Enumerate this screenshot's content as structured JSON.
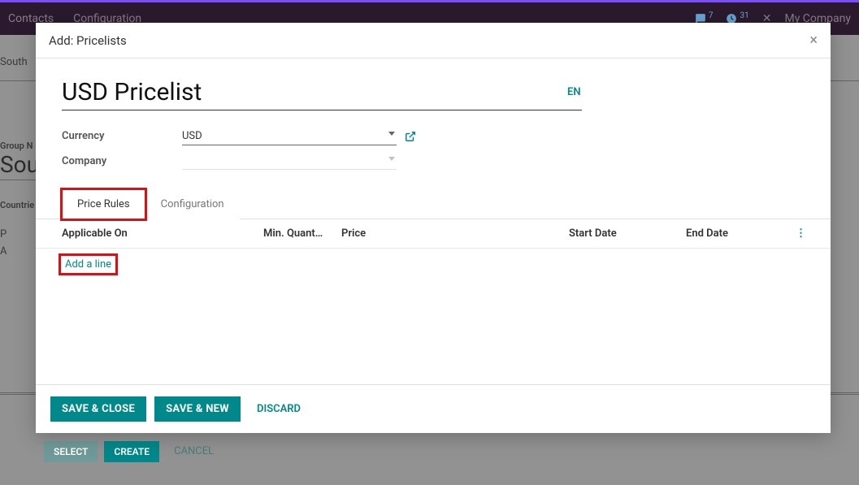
{
  "topnav": {
    "items": [
      "Contacts",
      "Configuration"
    ],
    "badges": {
      "messages": 7,
      "activities": 31
    },
    "company": "My Company"
  },
  "background": {
    "southText1": "South",
    "groupLabel": "Group N",
    "groupValue": "Sou",
    "countriesLabel": "Countrie",
    "p": "P",
    "a": "A",
    "select": "SELECT",
    "create": "CREATE",
    "cancel": "CANCEL"
  },
  "modal": {
    "title": "Add: Pricelists",
    "pricelistName": "USD Pricelist",
    "langBadge": "EN",
    "fields": {
      "currencyLabel": "Currency",
      "currencyValue": "USD",
      "companyLabel": "Company",
      "companyValue": ""
    },
    "tabs": {
      "priceRules": "Price Rules",
      "configuration": "Configuration"
    },
    "table": {
      "headers": {
        "applicable": "Applicable On",
        "qty": "Min. Quant…",
        "price": "Price",
        "start": "Start Date",
        "end": "End Date"
      },
      "addLine": "Add a line"
    },
    "footer": {
      "saveClose": "SAVE & CLOSE",
      "saveNew": "SAVE & NEW",
      "discard": "DISCARD"
    }
  }
}
